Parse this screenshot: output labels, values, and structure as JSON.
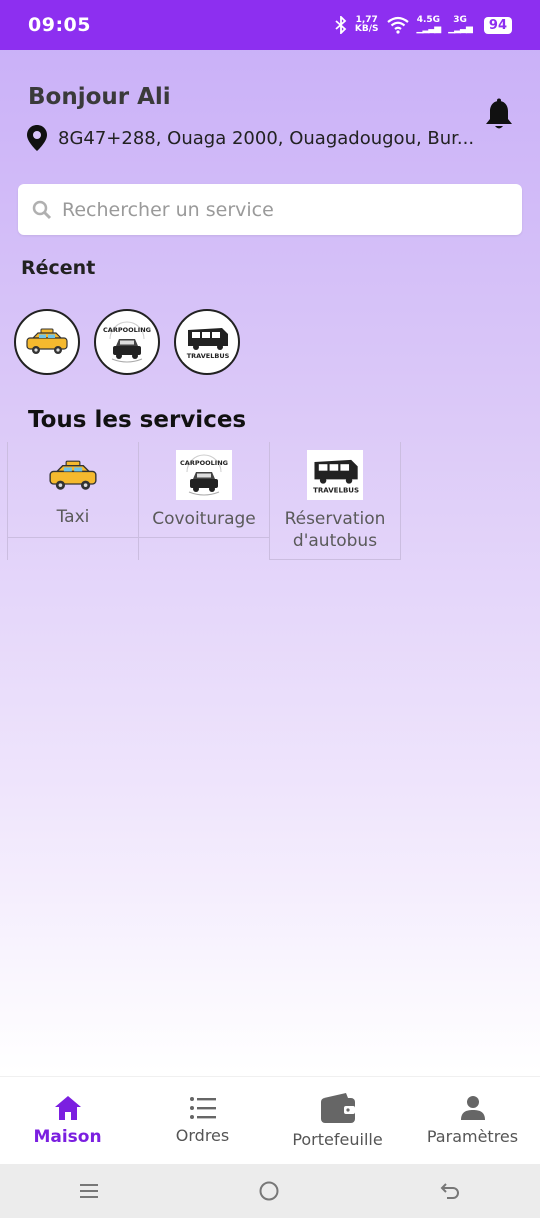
{
  "status_bar": {
    "time": "09:05",
    "speed_value": "1,77",
    "speed_unit": "KB/S",
    "net1": "4.5G",
    "net2": "3G",
    "battery": "94"
  },
  "header": {
    "greeting": "Bonjour Ali",
    "location": "8G47+288, Ouaga 2000, Ouagadougou, Bur..."
  },
  "search": {
    "placeholder": "Rechercher un service"
  },
  "recent": {
    "title": "Récent",
    "items": [
      {
        "icon": "taxi-icon"
      },
      {
        "icon": "carpooling-logo",
        "logo_text": "CARPOOLING"
      },
      {
        "icon": "travelbus-logo",
        "logo_text": "TRAVELBUS"
      }
    ]
  },
  "services": {
    "title": "Tous les services",
    "items": [
      {
        "label": "Taxi",
        "icon": "taxi-icon"
      },
      {
        "label": "Covoiturage",
        "icon": "carpooling-logo"
      },
      {
        "label": "Réservation d'autobus",
        "icon": "travelbus-logo"
      }
    ]
  },
  "bottom_nav": {
    "items": [
      {
        "label": "Maison",
        "icon": "home-icon",
        "active": true
      },
      {
        "label": "Ordres",
        "icon": "list-icon",
        "active": false
      },
      {
        "label": "Portefeuille",
        "icon": "wallet-icon",
        "active": false
      },
      {
        "label": "Paramètres",
        "icon": "person-icon",
        "active": false
      }
    ]
  },
  "colors": {
    "accent": "#8d2ff0",
    "active_nav": "#7b1fe0"
  }
}
